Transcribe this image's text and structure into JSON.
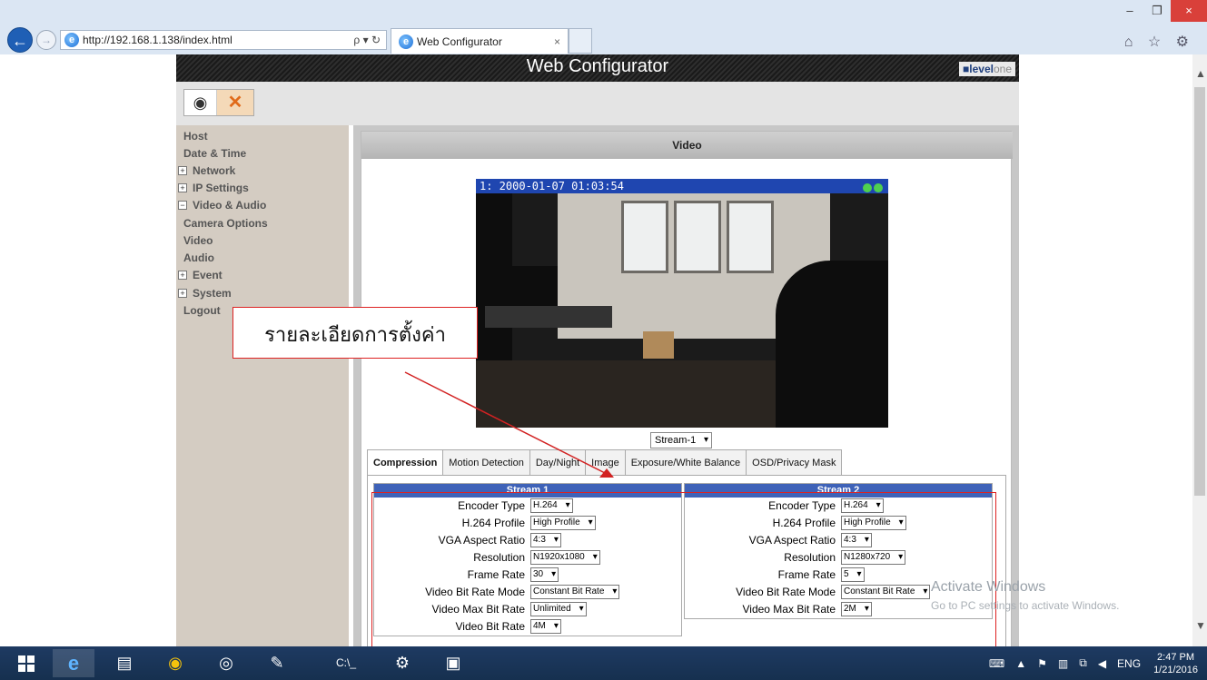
{
  "browser": {
    "url": "http://192.168.1.138/index.html",
    "search_glyph": "ρ ▾ ↻",
    "tab_title": "Web Configurator",
    "tab_close": "×",
    "window_buttons": {
      "minimize": "–",
      "restore": "❐",
      "close": "×"
    },
    "toolbar_icons": "⌂ ☆ ⚙"
  },
  "header": {
    "title": "Web Configurator",
    "brand_primary": "level",
    "brand_secondary": "one",
    "brand_mark": "■"
  },
  "mode": {
    "view_icon": "◉",
    "setup_icon": "✕"
  },
  "sidebar": {
    "items": [
      {
        "label": "Host",
        "toggle": ""
      },
      {
        "label": "Date & Time",
        "toggle": ""
      },
      {
        "label": "Network",
        "toggle": "+"
      },
      {
        "label": "IP Settings",
        "toggle": "+"
      },
      {
        "label": "Video & Audio",
        "toggle": "−"
      },
      {
        "label": "Camera Options",
        "toggle": ""
      },
      {
        "label": "Video",
        "toggle": ""
      },
      {
        "label": "Audio",
        "toggle": ""
      },
      {
        "label": "Event",
        "toggle": "+"
      },
      {
        "label": "System",
        "toggle": "+"
      },
      {
        "label": "Logout",
        "toggle": ""
      }
    ]
  },
  "panel": {
    "title": "Video",
    "camera_overlay": "1:  2000-01-07 01:03:54",
    "stream_select": "Stream-1"
  },
  "tabs": [
    {
      "label": "Compression",
      "active": true
    },
    {
      "label": "Motion Detection",
      "active": false
    },
    {
      "label": "Day/Night",
      "active": false
    },
    {
      "label": "Image",
      "active": false
    },
    {
      "label": "Exposure/White Balance",
      "active": false
    },
    {
      "label": "OSD/Privacy Mask",
      "active": false
    }
  ],
  "streams": [
    {
      "title": "Stream 1",
      "fields": [
        {
          "label": "Encoder Type",
          "value": "H.264"
        },
        {
          "label": "H.264 Profile",
          "value": "High Profile"
        },
        {
          "label": "VGA Aspect Ratio",
          "value": "4:3"
        },
        {
          "label": "Resolution",
          "value": "N1920x1080"
        },
        {
          "label": "Frame Rate",
          "value": "30"
        },
        {
          "label": "Video Bit Rate Mode",
          "value": "Constant Bit Rate"
        },
        {
          "label": "Video Max Bit Rate",
          "value": "Unlimited"
        },
        {
          "label": "Video Bit Rate",
          "value": "4M"
        }
      ]
    },
    {
      "title": "Stream 2",
      "fields": [
        {
          "label": "Encoder Type",
          "value": "H.264"
        },
        {
          "label": "H.264 Profile",
          "value": "High Profile"
        },
        {
          "label": "VGA Aspect Ratio",
          "value": "4:3"
        },
        {
          "label": "Resolution",
          "value": "N1280x720"
        },
        {
          "label": "Frame Rate",
          "value": "5"
        },
        {
          "label": "Video Bit Rate Mode",
          "value": "Constant Bit Rate"
        },
        {
          "label": "Video Max Bit Rate",
          "value": "2M"
        }
      ]
    }
  ],
  "annotation": {
    "text": "รายละเอียดการตั้งค่า",
    "color": "#d22222"
  },
  "watermark": {
    "line1": "Activate Windows",
    "line2": "Go to PC settings to activate Windows."
  },
  "taskbar": {
    "language": "ENG",
    "time": "2:47 PM",
    "date": "1/21/2016"
  }
}
